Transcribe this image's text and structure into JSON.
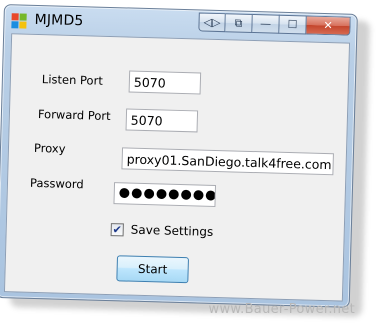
{
  "window": {
    "title": "MJMD5",
    "caption_buttons": {
      "back_fwd_glyph": "◁▷",
      "restore_glyph": "⧉",
      "minimize_glyph": "—",
      "maximize_glyph": "☐",
      "close_glyph": "✕"
    }
  },
  "form": {
    "listen_port_label": "Listen Port",
    "listen_port_value": "5070",
    "forward_port_label": "Forward Port",
    "forward_port_value": "5070",
    "proxy_label": "Proxy",
    "proxy_value": "proxy01.SanDiego.talk4free.com",
    "password_label": "Password",
    "password_value": "●●●●●●●●●●●●",
    "save_settings_label": "Save Settings",
    "save_settings_checked": true,
    "check_glyph": "✔",
    "start_label": "Start"
  },
  "watermark": "www.Bauer-Power.net",
  "colors": {
    "window_frame": "#aac4e0",
    "client_bg": "#f0f0f0",
    "close_button": "#c4452c",
    "start_button": "#bee6fd"
  },
  "icons": {
    "app": "windows-logo-icon"
  }
}
